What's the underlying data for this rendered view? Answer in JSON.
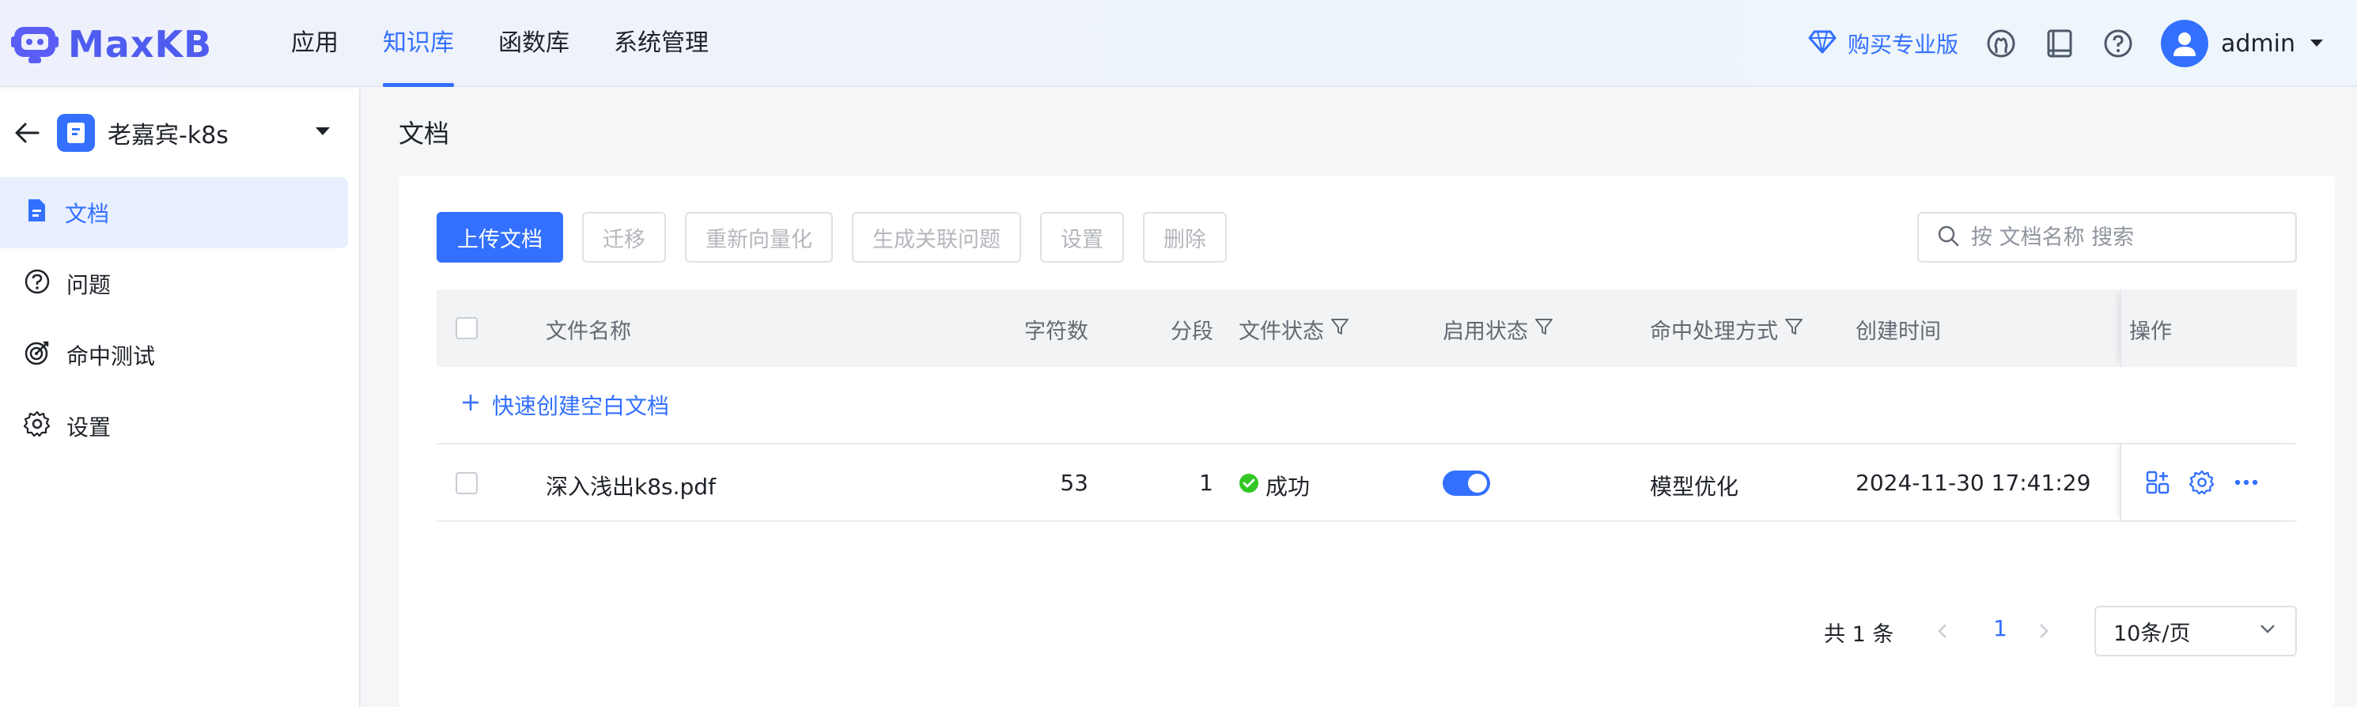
{
  "header": {
    "logo_text": "MaxKB",
    "nav": [
      {
        "label": "应用",
        "active": false
      },
      {
        "label": "知识库",
        "active": true
      },
      {
        "label": "函数库",
        "active": false
      },
      {
        "label": "系统管理",
        "active": false
      }
    ],
    "buy_label": "购买专业版",
    "username": "admin",
    "accent": "#3370ff"
  },
  "sidebar": {
    "kb_name": "老嘉宾-k8s",
    "items": [
      {
        "label": "文档",
        "icon": "document-icon",
        "active": true
      },
      {
        "label": "问题",
        "icon": "question-icon",
        "active": false
      },
      {
        "label": "命中测试",
        "icon": "target-icon",
        "active": false
      },
      {
        "label": "设置",
        "icon": "gear-icon",
        "active": false
      }
    ]
  },
  "main": {
    "title": "文档",
    "toolbar": {
      "upload": "上传文档",
      "migrate": "迁移",
      "revectorize": "重新向量化",
      "gen_questions": "生成关联问题",
      "settings": "设置",
      "delete": "删除"
    },
    "search_placeholder": "按 文档名称 搜索",
    "table": {
      "headers": {
        "name": "文件名称",
        "chars": "字符数",
        "segments": "分段",
        "file_status": "文件状态",
        "enabled": "启用状态",
        "hit_mode": "命中处理方式",
        "created": "创建时间",
        "ops": "操作"
      },
      "quick_create": "快速创建空白文档",
      "rows": [
        {
          "name": "深入浅出k8s.pdf",
          "chars": "53",
          "segments": "1",
          "status": "成功",
          "enabled": true,
          "hit_mode": "模型优化",
          "created": "2024-11-30 17:41:29"
        }
      ]
    },
    "pagination": {
      "total": "共 1 条",
      "current": "1",
      "page_size": "10条/页"
    }
  }
}
